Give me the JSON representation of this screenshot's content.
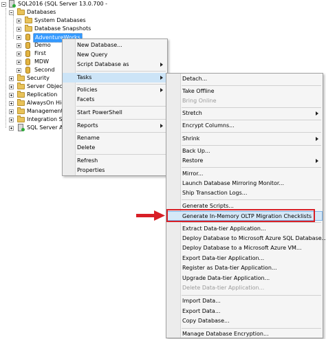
{
  "tree": {
    "server": "SQL2016 (SQL Server 13.0.700 -",
    "databases": "Databases",
    "system_databases": "System Databases",
    "database_snapshots": "Database Snapshots",
    "adventureworks": "AdventureWorks",
    "demo": "Demo",
    "first": "First",
    "mdw": "MDW",
    "second": "Second",
    "security": "Security",
    "server_objects": "Server Objects",
    "replication": "Replication",
    "alwayson": "AlwaysOn High",
    "management": "Management",
    "integration": "Integration Ser",
    "agent": "SQL Server Age"
  },
  "context_menu": {
    "new_database": "New Database...",
    "new_query": "New Query",
    "script_database_as": "Script Database as",
    "tasks": "Tasks",
    "policies": "Policies",
    "facets": "Facets",
    "start_powershell": "Start PowerShell",
    "reports": "Reports",
    "rename": "Rename",
    "delete": "Delete",
    "refresh": "Refresh",
    "properties": "Properties"
  },
  "tasks_menu": {
    "detach": "Detach...",
    "take_offline": "Take Offline",
    "bring_online": "Bring Online",
    "stretch": "Stretch",
    "encrypt_columns": "Encrypt Columns...",
    "shrink": "Shrink",
    "back_up": "Back Up...",
    "restore": "Restore",
    "mirror": "Mirror...",
    "launch_mirroring_monitor": "Launch Database Mirroring Monitor...",
    "ship_transaction_logs": "Ship Transaction Logs...",
    "generate_scripts": "Generate Scripts...",
    "generate_inmemory": "Generate In-Memory OLTP Migration Checklists",
    "extract_datatier": "Extract Data-tier Application...",
    "deploy_azure_sql": "Deploy Database to Microsoft Azure SQL Database...",
    "deploy_azure_vm": "Deploy Database to a Microsoft Azure VM...",
    "export_datatier": "Export Data-tier Application...",
    "register_datatier": "Register as Data-tier Application...",
    "upgrade_datatier": "Upgrade Data-tier Application...",
    "delete_datatier": "Delete Data-tier Application...",
    "import_data": "Import Data...",
    "export_data": "Export Data...",
    "copy_database": "Copy Database...",
    "manage_encryption": "Manage Database Encryption..."
  },
  "colors": {
    "highlight_box": "#d81f26",
    "selection": "#3399ff"
  }
}
